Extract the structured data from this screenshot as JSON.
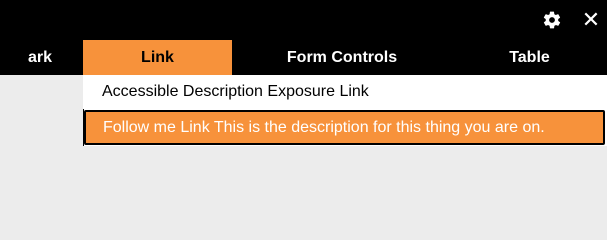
{
  "toolbar": {
    "settings_icon": "gear-icon",
    "close_icon": "close-icon",
    "close_glyph": "✕"
  },
  "tabs": [
    {
      "label": "Bookmark",
      "visible_label": "ark",
      "selected": false
    },
    {
      "label": "Link",
      "selected": true
    },
    {
      "label": "Form Controls",
      "selected": false
    },
    {
      "label": "Table",
      "selected": false
    }
  ],
  "menu": {
    "items": [
      {
        "label": "Accessible Description Exposure Link",
        "highlighted": false
      },
      {
        "label": "Follow me Link This is the description for this thing you are on.",
        "highlighted": true
      }
    ]
  },
  "colors": {
    "accent": "#f7923b",
    "bar": "#000000",
    "background": "#ececec"
  }
}
